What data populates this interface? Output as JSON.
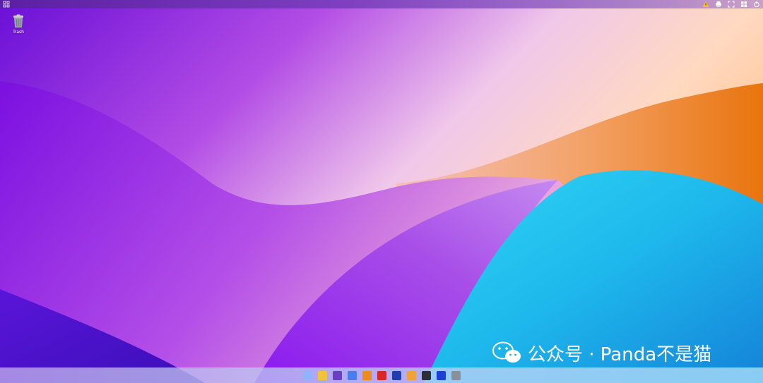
{
  "desktop": {
    "icons": [
      {
        "label": "Trash",
        "icon": "trash-icon"
      }
    ]
  },
  "topbar": {
    "left_icon": "app-launcher-icon",
    "tray_icons": [
      "warning-icon",
      "printer-icon",
      "fullscreen-icon",
      "grid-icon",
      "power-icon"
    ]
  },
  "dock": {
    "apps": [
      {
        "icon": "app-grid-icon",
        "color": "#8fb4ff"
      },
      {
        "icon": "file-manager-icon",
        "color": "#f2c23a"
      },
      {
        "icon": "font-viewer-icon",
        "color": "#6a3fc4"
      },
      {
        "icon": "color-palette-icon",
        "color": "#4a7cf0"
      },
      {
        "icon": "brush-icon",
        "color": "#f08a1c"
      },
      {
        "icon": "code-editor-icon",
        "color": "#d9262b"
      },
      {
        "icon": "browser-icon",
        "color": "#1f3fae"
      },
      {
        "icon": "audio-recorder-icon",
        "color": "#f0a23a"
      },
      {
        "icon": "terminal-icon",
        "color": "#2b2f38"
      },
      {
        "icon": "network-icon",
        "color": "#1d3fd8"
      },
      {
        "icon": "trash-icon",
        "color": "#8a8f99"
      }
    ]
  },
  "watermark": {
    "text": "公众号 · Panda不是猫",
    "icon": "wechat-icon"
  },
  "wallpaper": {
    "colors": {
      "purple": "#8b2be2",
      "violet": "#a846e8",
      "orange": "#f08a26",
      "cyan": "#21c8f0",
      "blue": "#1a8de0"
    }
  }
}
